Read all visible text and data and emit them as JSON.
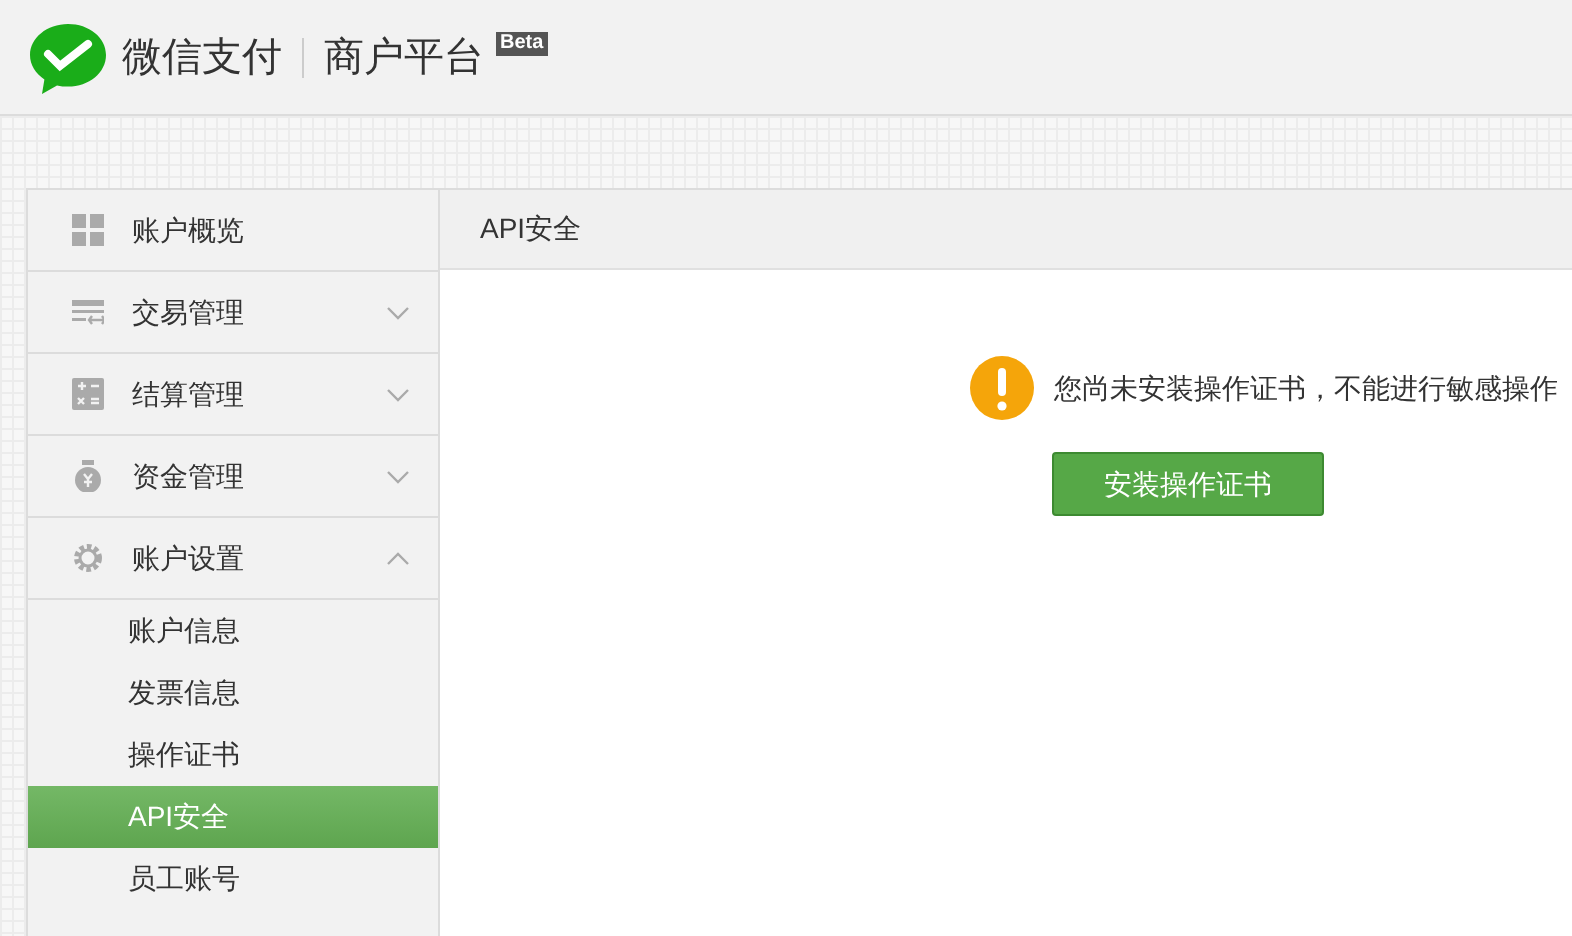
{
  "header": {
    "brand": "微信支付",
    "product": "商户平台",
    "badge": "Beta"
  },
  "sidebar": {
    "items": [
      {
        "kind": "overview",
        "label": "账户概览"
      },
      {
        "kind": "trade",
        "label": "交易管理",
        "expanded": false
      },
      {
        "kind": "settle",
        "label": "结算管理",
        "expanded": false
      },
      {
        "kind": "fund",
        "label": "资金管理",
        "expanded": false
      },
      {
        "kind": "settings",
        "label": "账户设置",
        "expanded": true,
        "children": [
          {
            "label": "账户信息",
            "selected": false
          },
          {
            "label": "发票信息",
            "selected": false
          },
          {
            "label": "操作证书",
            "selected": false
          },
          {
            "label": "API安全",
            "selected": true
          },
          {
            "label": "员工账号",
            "selected": false
          }
        ]
      }
    ]
  },
  "panel": {
    "title": "API安全",
    "warning": "您尚未安装操作证书，不能进行敏感操作",
    "button": "安装操作证书"
  }
}
